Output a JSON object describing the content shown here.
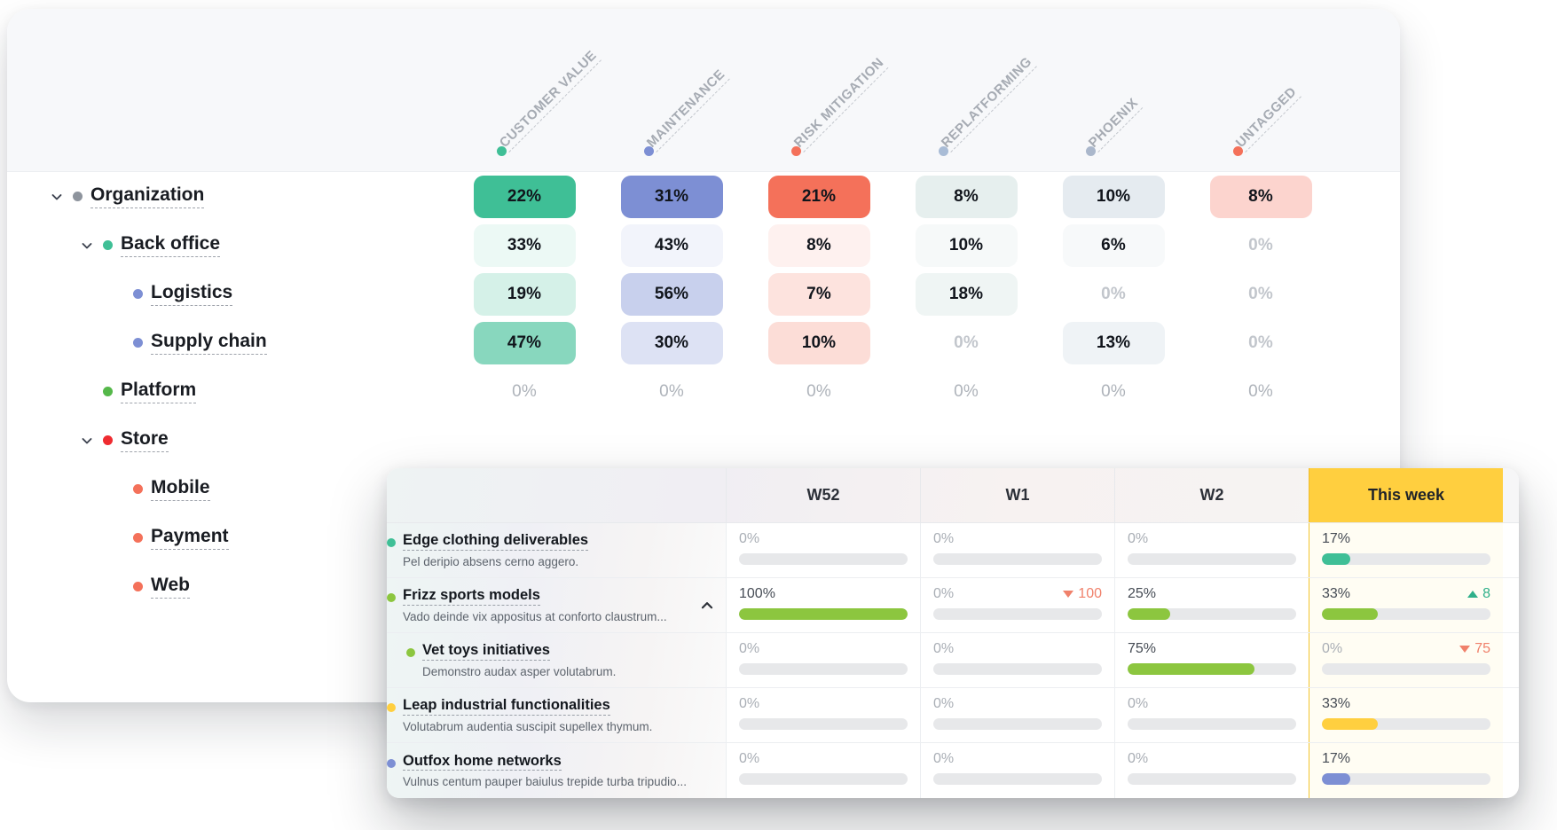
{
  "matrix": {
    "columns": [
      {
        "label": "CUSTOMER VALUE",
        "dot_color": "#3fbf96",
        "base_color": "#3fbf96",
        "icon": "category-dot-icon"
      },
      {
        "label": "MAINTENANCE",
        "dot_color": "#7d8fd4",
        "base_color": "#7d8fd4",
        "icon": "category-dot-icon"
      },
      {
        "label": "RISK MITIGATION",
        "dot_color": "#f4715a",
        "base_color": "#f4715a",
        "icon": "category-dot-icon"
      },
      {
        "label": "REPLATFORMING",
        "dot_color": "#a9bcd6",
        "base_color": "#8fb7b3",
        "icon": "category-dot-icon"
      },
      {
        "label": "PHOENIX",
        "dot_color": "#aab7cb",
        "base_color": "#9bb3c4",
        "icon": "category-dot-icon"
      },
      {
        "label": "UNTAGGED",
        "dot_color": "#f4715a",
        "base_color": "#f4715a",
        "icon": "category-dot-icon"
      }
    ],
    "rows": [
      {
        "label": "Organization",
        "dot_color": "#8e949d",
        "depth": 0,
        "expanded": true,
        "caret": "chevron-down-icon",
        "values": [
          "22%",
          "31%",
          "21%",
          "8%",
          "10%",
          "8%"
        ],
        "intensity": [
          1.0,
          1.0,
          1.0,
          0.22,
          0.26,
          0.3
        ]
      },
      {
        "label": "Back office",
        "dot_color": "#3fbf96",
        "depth": 1,
        "expanded": true,
        "caret": "chevron-down-icon",
        "values": [
          "33%",
          "43%",
          "8%",
          "10%",
          "6%",
          "0%"
        ],
        "intensity": [
          0.1,
          0.1,
          0.1,
          0.08,
          0.08,
          0.05
        ]
      },
      {
        "label": "Logistics",
        "dot_color": "#7d8fd4",
        "depth": 2,
        "expanded": false,
        "caret": "none",
        "values": [
          "19%",
          "56%",
          "7%",
          "18%",
          "0%",
          "0%"
        ],
        "intensity": [
          0.22,
          0.42,
          0.2,
          0.14,
          0.05,
          0.05
        ]
      },
      {
        "label": "Supply chain",
        "dot_color": "#7d8fd4",
        "depth": 2,
        "expanded": false,
        "caret": "none",
        "values": [
          "47%",
          "30%",
          "10%",
          "0%",
          "13%",
          "0%"
        ],
        "intensity": [
          0.62,
          0.26,
          0.24,
          0.05,
          0.16,
          0.05
        ]
      },
      {
        "label": "Platform",
        "dot_color": "#55b84a",
        "depth": 1,
        "expanded": false,
        "caret": "none",
        "values": [
          "0%",
          "0%",
          "0%",
          "0%",
          "0%",
          "0%"
        ],
        "intensity": [
          0,
          0,
          0,
          0,
          0,
          0
        ]
      },
      {
        "label": "Store",
        "dot_color": "#ef2b30",
        "depth": 1,
        "expanded": true,
        "caret": "chevron-down-icon",
        "values": [
          "",
          "",
          "",
          "",
          "",
          ""
        ],
        "intensity": [
          0,
          0,
          0,
          0,
          0,
          0
        ]
      },
      {
        "label": "Mobile",
        "dot_color": "#f4715a",
        "depth": 2,
        "expanded": false,
        "caret": "none",
        "values": [
          "",
          "",
          "",
          "",
          "",
          ""
        ],
        "intensity": [
          0,
          0,
          0,
          0,
          0,
          0
        ]
      },
      {
        "label": "Payment",
        "dot_color": "#f4715a",
        "depth": 2,
        "expanded": false,
        "caret": "none",
        "values": [
          "",
          "",
          "",
          "",
          "",
          ""
        ],
        "intensity": [
          0,
          0,
          0,
          0,
          0,
          0
        ]
      },
      {
        "label": "Web",
        "dot_color": "#f4715a",
        "depth": 2,
        "expanded": false,
        "caret": "none",
        "values": [
          "",
          "",
          "",
          "",
          "",
          ""
        ],
        "intensity": [
          0,
          0,
          0,
          0,
          0,
          0
        ]
      }
    ]
  },
  "panel": {
    "name_column_header": "",
    "week_columns": [
      {
        "label": "W52",
        "current": false
      },
      {
        "label": "W1",
        "current": false
      },
      {
        "label": "W2",
        "current": false
      },
      {
        "label": "This week",
        "current": true
      }
    ],
    "current_column_color": "#ffcf3f",
    "rows": [
      {
        "title": "Edge clothing deliverables",
        "subtitle": "Pel deripio absens cerno aggero.",
        "dot_color": "#3fbf96",
        "nested": false,
        "collapse_icon": "none",
        "cells": [
          {
            "value": "0%",
            "pct": 0,
            "bar_color": "#e7e8ea",
            "delta": "",
            "delta_dir": ""
          },
          {
            "value": "0%",
            "pct": 0,
            "bar_color": "#e7e8ea",
            "delta": "",
            "delta_dir": ""
          },
          {
            "value": "0%",
            "pct": 0,
            "bar_color": "#e7e8ea",
            "delta": "",
            "delta_dir": ""
          },
          {
            "value": "17%",
            "pct": 17,
            "bar_color": "#3fbf96",
            "delta": "",
            "delta_dir": ""
          }
        ]
      },
      {
        "title": "Frizz sports models",
        "subtitle": "Vado deinde vix appositus at conforto claustrum...",
        "dot_color": "#8cc63f",
        "nested": false,
        "collapse_icon": "chevron-up-icon",
        "cells": [
          {
            "value": "100%",
            "pct": 100,
            "bar_color": "#8cc63f",
            "delta": "",
            "delta_dir": ""
          },
          {
            "value": "0%",
            "pct": 0,
            "bar_color": "#e7e8ea",
            "delta": "100",
            "delta_dir": "down"
          },
          {
            "value": "25%",
            "pct": 25,
            "bar_color": "#8cc63f",
            "delta": "",
            "delta_dir": ""
          },
          {
            "value": "33%",
            "pct": 33,
            "bar_color": "#8cc63f",
            "delta": "8",
            "delta_dir": "up"
          }
        ]
      },
      {
        "title": "Vet toys initiatives",
        "subtitle": "Demonstro audax asper volutabrum.",
        "dot_color": "#8cc63f",
        "nested": true,
        "collapse_icon": "none",
        "cells": [
          {
            "value": "0%",
            "pct": 0,
            "bar_color": "#e7e8ea",
            "delta": "",
            "delta_dir": ""
          },
          {
            "value": "0%",
            "pct": 0,
            "bar_color": "#e7e8ea",
            "delta": "",
            "delta_dir": ""
          },
          {
            "value": "75%",
            "pct": 75,
            "bar_color": "#8cc63f",
            "delta": "",
            "delta_dir": ""
          },
          {
            "value": "0%",
            "pct": 0,
            "bar_color": "#e7e8ea",
            "delta": "75",
            "delta_dir": "down"
          }
        ]
      },
      {
        "title": "Leap industrial functionalities",
        "subtitle": "Volutabrum audentia suscipit supellex thymum.",
        "dot_color": "#ffcf3f",
        "nested": false,
        "collapse_icon": "none",
        "cells": [
          {
            "value": "0%",
            "pct": 0,
            "bar_color": "#e7e8ea",
            "delta": "",
            "delta_dir": ""
          },
          {
            "value": "0%",
            "pct": 0,
            "bar_color": "#e7e8ea",
            "delta": "",
            "delta_dir": ""
          },
          {
            "value": "0%",
            "pct": 0,
            "bar_color": "#e7e8ea",
            "delta": "",
            "delta_dir": ""
          },
          {
            "value": "33%",
            "pct": 33,
            "bar_color": "#ffcf3f",
            "delta": "",
            "delta_dir": ""
          }
        ]
      },
      {
        "title": "Outfox home networks",
        "subtitle": "Vulnus centum pauper baiulus trepide turba tripudio...",
        "dot_color": "#7d8fd4",
        "nested": false,
        "collapse_icon": "none",
        "cells": [
          {
            "value": "0%",
            "pct": 0,
            "bar_color": "#e7e8ea",
            "delta": "",
            "delta_dir": ""
          },
          {
            "value": "0%",
            "pct": 0,
            "bar_color": "#e7e8ea",
            "delta": "",
            "delta_dir": ""
          },
          {
            "value": "0%",
            "pct": 0,
            "bar_color": "#e7e8ea",
            "delta": "",
            "delta_dir": ""
          },
          {
            "value": "17%",
            "pct": 17,
            "bar_color": "#7d8fd4",
            "delta": "",
            "delta_dir": ""
          }
        ]
      }
    ]
  }
}
